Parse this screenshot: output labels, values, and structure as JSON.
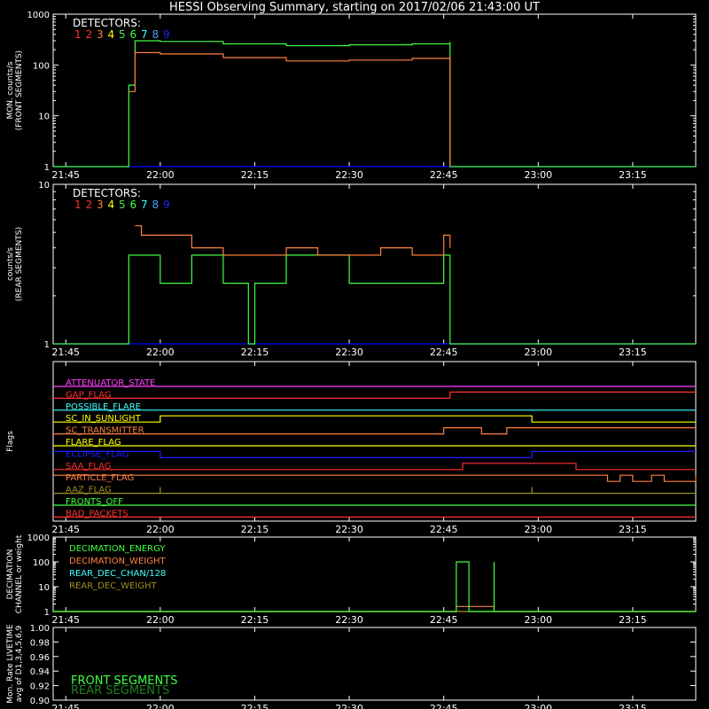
{
  "title": "HESSI Observing Summary, starting on 2017/02/06 21:43:00 UT",
  "time_axis": {
    "start": "21:43",
    "end": "23:25",
    "ticks": [
      "21:45",
      "22:00",
      "22:15",
      "22:30",
      "22:45",
      "23:00",
      "23:15"
    ]
  },
  "colors": {
    "background": "#000000",
    "axes": "#ffffff",
    "baseline": "#0000ff",
    "det": [
      "#ff3030",
      "#ff3030",
      "#ff8040",
      "#ffff00",
      "#50e050",
      "#40ff40",
      "#40ffff",
      "#40a0ff",
      "#2020ff"
    ]
  },
  "chart_data": [
    {
      "type": "line",
      "id": "front",
      "ylabel": "MON. counts/s\n(FRONT SEGMENTS)",
      "yscale": "log",
      "ylim": [
        1,
        1000
      ],
      "yticks": [
        "1",
        "10",
        "100",
        "1000"
      ],
      "legend_title": "DETECTORS:",
      "legend_numbers": [
        "1",
        "2",
        "3",
        "4",
        "5",
        "6",
        "7",
        "8",
        "9"
      ],
      "legend_colors": [
        "#ff3030",
        "#ff3030",
        "#ff8040",
        "#ffff00",
        "#50e050",
        "#40ff40",
        "#40ffff",
        "#40a0ff",
        "#2020ff"
      ],
      "series": [
        {
          "color": "#40ff40",
          "x": [
            "21:43",
            "21:55",
            "21:55",
            "21:56",
            "22:00",
            "22:10",
            "22:20",
            "22:30",
            "22:40",
            "22:46",
            "22:46",
            "23:25"
          ],
          "y": [
            1,
            1,
            40,
            300,
            290,
            260,
            240,
            250,
            260,
            285,
            1,
            1
          ]
        },
        {
          "color": "#ff8040",
          "x": [
            "21:55",
            "21:56",
            "22:00",
            "22:10",
            "22:20",
            "22:30",
            "22:40",
            "22:46",
            "22:46"
          ],
          "y": [
            30,
            175,
            165,
            140,
            120,
            125,
            135,
            150,
            1
          ]
        }
      ]
    },
    {
      "type": "line",
      "id": "rear",
      "ylabel": "counts/s\n(REAR SEGMENTS)",
      "yscale": "log",
      "ylim": [
        1,
        10
      ],
      "yticks": [
        "1",
        "10"
      ],
      "legend_title": "DETECTORS:",
      "legend_numbers": [
        "1",
        "2",
        "3",
        "4",
        "5",
        "6",
        "7",
        "8",
        "9"
      ],
      "legend_colors": [
        "#ff3030",
        "#ff3030",
        "#ff8040",
        "#ffff00",
        "#50e050",
        "#40ff40",
        "#40ffff",
        "#40a0ff",
        "#2020ff"
      ],
      "series": [
        {
          "color": "#40ff40",
          "x": [
            "21:43",
            "21:55",
            "21:55",
            "21:56",
            "22:00",
            "22:05",
            "22:10",
            "22:14",
            "22:15",
            "22:20",
            "22:30",
            "22:40",
            "22:45",
            "22:46",
            "22:46",
            "23:25"
          ],
          "y": [
            1,
            1,
            3.6,
            3.6,
            2.4,
            3.6,
            2.4,
            1.0,
            2.4,
            3.6,
            2.4,
            2.4,
            3.6,
            3.6,
            1,
            1
          ]
        },
        {
          "color": "#ff8040",
          "x": [
            "21:56",
            "21:57",
            "22:00",
            "22:05",
            "22:10",
            "22:15",
            "22:20",
            "22:25",
            "22:30",
            "22:35",
            "22:40",
            "22:45",
            "22:46"
          ],
          "y": [
            5.5,
            4.8,
            4.8,
            4.0,
            3.6,
            3.6,
            4.0,
            3.6,
            3.6,
            4.0,
            3.6,
            4.8,
            4.0
          ]
        }
      ]
    },
    {
      "type": "line",
      "id": "flags",
      "ylabel": "Flags",
      "series": [
        {
          "name": "ATTENUATOR_STATE",
          "color": "#ff40ff",
          "x": [
            "21:43",
            "23:25"
          ],
          "y": [
            0,
            0
          ]
        },
        {
          "name": "GAP_FLAG",
          "color": "#ff3030",
          "x": [
            "21:43",
            "22:46",
            "22:46",
            "23:25"
          ],
          "y": [
            0,
            0,
            1,
            1
          ]
        },
        {
          "name": "POSSIBLE_FLARE",
          "color": "#40ffff",
          "x": [
            "21:43",
            "23:25"
          ],
          "y": [
            0,
            0
          ]
        },
        {
          "name": "SC_IN_SUNLIGHT",
          "color": "#ffff00",
          "x": [
            "21:43",
            "22:00",
            "22:00",
            "22:59",
            "22:59",
            "23:25"
          ],
          "y": [
            0,
            0,
            1,
            1,
            0,
            0
          ]
        },
        {
          "name": "SC_TRANSMITTER",
          "color": "#ff8040",
          "x": [
            "21:43",
            "22:45",
            "22:45",
            "22:51",
            "22:51",
            "22:55",
            "22:55",
            "23:25"
          ],
          "y": [
            0,
            0,
            1,
            1,
            0,
            0,
            1,
            1
          ]
        },
        {
          "name": "FLARE_FLAG",
          "color": "#ffff00",
          "x": [
            "21:43",
            "23:25"
          ],
          "y": [
            0,
            0
          ]
        },
        {
          "name": "ECLIPSE_FLAG",
          "color": "#2020ff",
          "x": [
            "21:43",
            "22:00",
            "22:00",
            "22:59",
            "22:59",
            "23:25"
          ],
          "y": [
            1,
            1,
            0,
            0,
            1,
            1
          ]
        },
        {
          "name": "SAA_FLAG",
          "color": "#ff3030",
          "x": [
            "21:43",
            "22:48",
            "22:48",
            "23:06",
            "23:06",
            "23:25"
          ],
          "y": [
            0,
            0,
            1,
            1,
            0,
            0
          ]
        },
        {
          "name": "PARTICLE_FLAG",
          "color": "#ff8040",
          "x": [
            "21:43",
            "23:10",
            "23:11",
            "23:13",
            "23:15",
            "23:18",
            "23:20",
            "23:25"
          ],
          "y": [
            1,
            1,
            0,
            1,
            0,
            1,
            0,
            1
          ]
        },
        {
          "name": "AAZ_FLAG",
          "color": "#a09020",
          "x": [
            "21:43",
            "22:00",
            "22:00",
            "22:00",
            "22:00",
            "22:59",
            "22:59",
            "22:59",
            "22:59",
            "23:25"
          ],
          "y": [
            0,
            0,
            1,
            1,
            0,
            0,
            1,
            1,
            0,
            0
          ]
        },
        {
          "name": "FRONTS_OFF",
          "color": "#40ff40",
          "x": [
            "21:43",
            "23:25"
          ],
          "y": [
            0,
            0
          ]
        },
        {
          "name": "BAD_PACKETS",
          "color": "#ff3030",
          "x": [
            "21:43",
            "23:25"
          ],
          "y": [
            0,
            0
          ]
        }
      ]
    },
    {
      "type": "line",
      "id": "decimation",
      "ylabel": "DECIMATION\nCHANNEL or weight",
      "yscale": "log",
      "ylim": [
        1,
        1000
      ],
      "yticks": [
        "1",
        "10",
        "100",
        "1000"
      ],
      "series": [
        {
          "name": "DECIMATION_ENERGY",
          "color": "#40ff40",
          "x": [
            "21:43",
            "22:47",
            "22:47",
            "22:49",
            "22:49",
            "22:53",
            "22:53",
            "23:25"
          ],
          "y": [
            1,
            1,
            100,
            100,
            1,
            100,
            1,
            1
          ]
        },
        {
          "name": "DECIMATION_WEIGHT",
          "color": "#ff8040",
          "x": [
            "21:43",
            "22:47",
            "22:47",
            "22:53",
            "22:53",
            "23:25"
          ],
          "y": [
            1,
            1,
            1.6,
            1.6,
            1,
            1
          ]
        },
        {
          "name": "REAR_DEC_CHAN/128",
          "color": "#40ffff",
          "x": [],
          "y": []
        },
        {
          "name": "REAR_DEC_WEIGHT",
          "color": "#a09020",
          "x": [
            "21:43",
            "23:25"
          ],
          "y": [
            1,
            1
          ]
        }
      ]
    },
    {
      "type": "line",
      "id": "livetime",
      "ylabel": "Mon. Rate LIVETIME\navg of D1,3,4,5,6,9",
      "ylim": [
        0.9,
        1.0
      ],
      "yticks": [
        "0.90",
        "0.92",
        "0.94",
        "0.96",
        "0.98",
        "1.00"
      ],
      "series": [
        {
          "name": "FRONT SEGMENTS",
          "color": "#40ff40",
          "x": [],
          "y": []
        },
        {
          "name": "REAR SEGMENTS",
          "color": "#208020",
          "x": [],
          "y": []
        }
      ]
    }
  ]
}
